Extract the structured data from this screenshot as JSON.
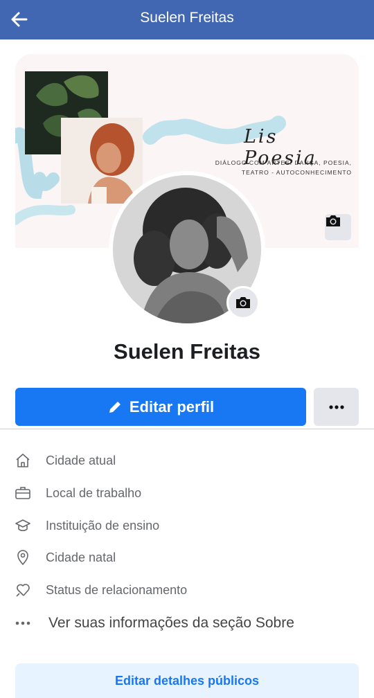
{
  "header": {
    "title": "Suelen Freitas",
    "back_icon": "arrow-left-icon",
    "bar_color": "#4267b2"
  },
  "cover": {
    "brand_name": "Lis Poesia",
    "brand_tagline": "DIÁLOGO COM ARTES: DANÇA, POESIA, TEATRO - AUTOCONHECIMENTO",
    "camera_icon": "camera-icon"
  },
  "profile": {
    "name": "Suelen Freitas",
    "avatar_camera_icon": "camera-icon"
  },
  "actions": {
    "edit_profile_label": "Editar perfil",
    "edit_profile_icon": "pencil-icon",
    "more_icon": "more-horizontal-icon",
    "primary_color": "#1877f2"
  },
  "info": {
    "items": [
      {
        "label": "Cidade atual",
        "icon": "house-icon"
      },
      {
        "label": "Local de trabalho",
        "icon": "briefcase-icon"
      },
      {
        "label": "Instituição de ensino",
        "icon": "graduation-cap-icon"
      },
      {
        "label": "Cidade natal",
        "icon": "location-pin-icon"
      },
      {
        "label": "Status de relacionamento",
        "icon": "heart-icon"
      }
    ],
    "see_about_label": "Ver suas informações da seção Sobre",
    "see_about_icon": "more-horizontal-icon"
  },
  "footer": {
    "edit_details_label": "Editar detalhes públicos"
  }
}
